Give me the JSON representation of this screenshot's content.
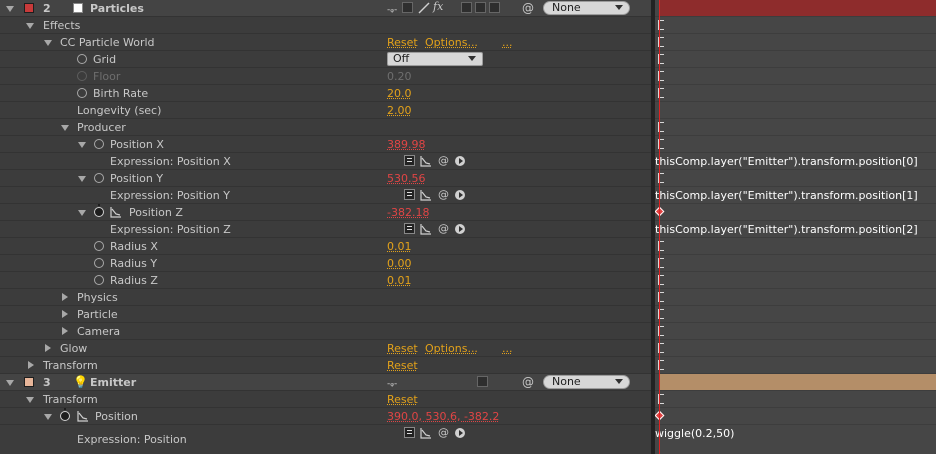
{
  "colors": {
    "particles_label": "#c83a3a",
    "particles_bar": "#8e2c2c",
    "emitter_label": "#e8b69a",
    "emitter_bar": "#b48e68",
    "value_yellow": "#e3a21a",
    "value_red": "#e04545"
  },
  "layers": {
    "particles": {
      "index": "2",
      "name": "Particles",
      "parent": "None"
    },
    "emitter": {
      "index": "3",
      "name": "Emitter",
      "parent": "None"
    }
  },
  "labels": {
    "effects": "Effects",
    "cc_particle_world": "CC Particle World",
    "grid": "Grid",
    "floor": "Floor",
    "birth_rate": "Birth Rate",
    "longevity": "Longevity (sec)",
    "producer": "Producer",
    "position_x": "Position X",
    "expr_position_x": "Expression: Position X",
    "position_y": "Position Y",
    "expr_position_y": "Expression: Position Y",
    "position_z": "Position Z",
    "expr_position_z": "Expression: Position Z",
    "radius_x": "Radius X",
    "radius_y": "Radius Y",
    "radius_z": "Radius Z",
    "physics": "Physics",
    "particle": "Particle",
    "camera": "Camera",
    "glow": "Glow",
    "transform": "Transform",
    "transform2": "Transform",
    "position": "Position",
    "expr_position": "Expression: Position"
  },
  "links": {
    "reset": "Reset",
    "options": "Options...",
    "more": "...",
    "fx": "fx",
    "spiral": "@",
    "shy": "-̢̰-"
  },
  "values": {
    "grid": "Off",
    "floor": "0.20",
    "birth_rate": "20.0",
    "longevity": "2.00",
    "position_x": "389.98",
    "position_y": "530.56",
    "position_z": "-382.18",
    "radius_x": "0.01",
    "radius_y": "0.00",
    "radius_z": "0.01",
    "position": "390.0, 530.6, -382.2"
  },
  "expressions": {
    "position_x": "thisComp.layer(\"Emitter\").transform.position[0]",
    "position_y": "thisComp.layer(\"Emitter\").transform.position[1]",
    "position_z": "thisComp.layer(\"Emitter\").transform.position[2]",
    "position": "wiggle(0.2,50)"
  },
  "icons": {
    "stopwatch": "stopwatch-icon",
    "graph": "graph-editor-icon",
    "light": "light-bulb-icon",
    "solid": "solid-layer-icon",
    "pickwhip": "pickwhip-icon"
  }
}
